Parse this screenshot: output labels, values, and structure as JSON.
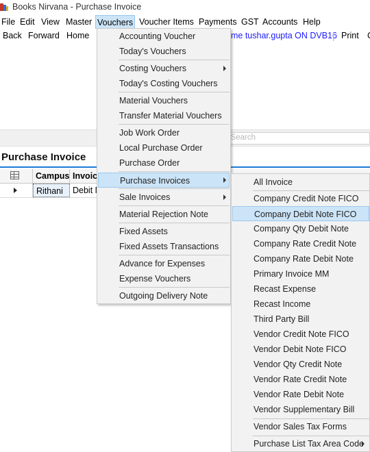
{
  "window": {
    "title": "Books Nirvana - Purchase Invoice"
  },
  "menubar": {
    "file": "File",
    "edit": "Edit",
    "view": "View",
    "master": "Master",
    "vouchers": "Vouchers",
    "voucher_items": "Voucher Items",
    "payments": "Payments",
    "gst": "GST",
    "accounts": "Accounts",
    "help": "Help"
  },
  "navbar": {
    "back": "Back",
    "forward": "Forward",
    "home": "Home",
    "user_info": "me tushar.gupta ON DVB16",
    "print": "Print",
    "extra": "C"
  },
  "search": {
    "placeholder": "o Search"
  },
  "section": {
    "title": "Purchase Invoice"
  },
  "grid": {
    "columns": [
      "Campus",
      "Invoic"
    ],
    "row": {
      "campus": "Rithani",
      "invoice": "Debit N"
    }
  },
  "vouchers_menu": {
    "accounting_voucher": "Accounting Voucher",
    "todays_vouchers": "Today's Vouchers",
    "costing_vouchers": "Costing Vouchers",
    "todays_costing_vouchers": "Today's Costing Vouchers",
    "material_vouchers": "Material Vouchers",
    "transfer_material_vouchers": "Transfer Material Vouchers",
    "job_work_order": "Job Work Order",
    "local_purchase_order": "Local Purchase Order",
    "purchase_order": "Purchase Order",
    "purchase_invoices": "Purchase Invoices",
    "sale_invoices": "Sale Invoices",
    "material_rejection_note": "Material Rejection Note",
    "fixed_assets": "Fixed Assets",
    "fixed_assets_transactions": "Fixed Assets Transactions",
    "advance_for_expenses": "Advance for Expenses",
    "expense_vouchers": "Expense Vouchers",
    "outgoing_delivery_note": "Outgoing Delivery Note"
  },
  "purchase_invoices_menu": {
    "all_invoice": "All Invoice",
    "company_credit_note_fico": "Company Credit Note FICO",
    "company_debit_note_fico": "Company Debit Note FICO",
    "company_qty_debit_note": "Company Qty Debit Note",
    "company_rate_credit_note": "Company Rate Credit Note",
    "company_rate_debit_note": "Company Rate Debit Note",
    "primary_invoice_mm": "Primary Invoice MM",
    "recast_expense": "Recast Expense",
    "recast_income": "Recast Income",
    "third_party_bill": "Third Party Bill",
    "vendor_credit_note_fico": "Vendor Credit Note FICO",
    "vendor_debit_note_fico": "Vendor Debit Note FICO",
    "vendor_qty_credit_note": "Vendor Qty Credit Note",
    "vendor_rate_credit_note": "Vendor Rate Credit Note",
    "vendor_rate_debit_note": "Vendor Rate Debit Note",
    "vendor_supplementary_bill": "Vendor Supplementary Bill",
    "vendor_sales_tax_forms": "Vendor Sales Tax Forms",
    "purchase_list_tax_area_code": "Purchase List Tax Area Code"
  },
  "colors": {
    "highlight": "#cce4f7",
    "highlight_border": "#99c8ee",
    "accent": "#1c7bd6",
    "user_link": "#1a1aff"
  }
}
